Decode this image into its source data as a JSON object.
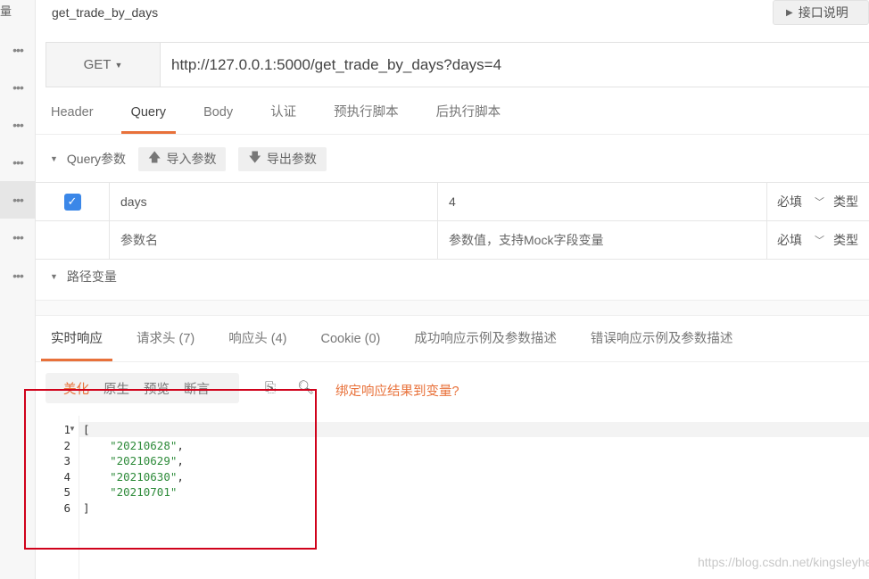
{
  "rail": {
    "top_label": "量",
    "dots": [
      "•••",
      "•••",
      "•••",
      "•••",
      "•••",
      "•••",
      "•••"
    ]
  },
  "api": {
    "title": "get_trade_by_days",
    "doc_button": "接口说明"
  },
  "request": {
    "method": "GET",
    "url": "http://127.0.0.1:5000/get_trade_by_days?days=4"
  },
  "request_tabs": [
    "Header",
    "Query",
    "Body",
    "认证",
    "预执行脚本",
    "后执行脚本"
  ],
  "query": {
    "section_label": "Query参数",
    "import_label": "导入参数",
    "export_label": "导出参数",
    "rows": [
      {
        "name": "days",
        "value": "4",
        "required": "必填",
        "type": "类型"
      }
    ],
    "placeholder_row": {
      "name": "参数名",
      "value": "参数值，支持Mock字段变量",
      "required": "必填",
      "type": "类型"
    }
  },
  "path_vars": {
    "section_label": "路径变量"
  },
  "response_tabs": [
    "实时响应",
    "请求头 (7)",
    "响应头 (4)",
    "Cookie (0)",
    "成功响应示例及参数描述",
    "错误响应示例及参数描述"
  ],
  "response_formats": [
    "美化",
    "原生",
    "预览",
    "断言"
  ],
  "bind_link": "绑定响应结果到变量?",
  "code": {
    "lines": [
      {
        "n": "1",
        "open": "["
      },
      {
        "n": "2",
        "text": "\"20210628\"",
        "comma": ","
      },
      {
        "n": "3",
        "text": "\"20210629\"",
        "comma": ","
      },
      {
        "n": "4",
        "text": "\"20210630\"",
        "comma": ","
      },
      {
        "n": "5",
        "text": "\"20210701\"",
        "comma": ""
      },
      {
        "n": "6",
        "close": "]"
      }
    ]
  },
  "watermark": "https://blog.csdn.net/kingsleyhe",
  "colors": {
    "accent": "#e8713a",
    "checkbox": "#3b87e8",
    "annotation_box": "#d0021b",
    "json_string": "#2e8b3a"
  }
}
